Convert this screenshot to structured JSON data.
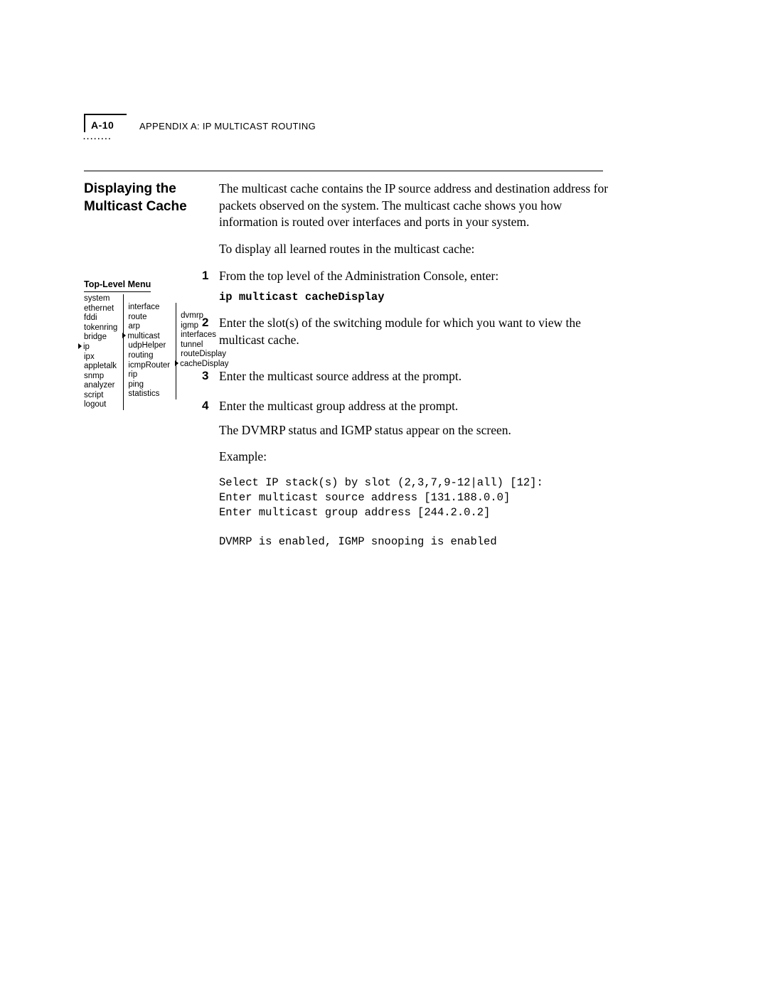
{
  "header": {
    "page_number": "A-10",
    "appendix_prefix": "A",
    "appendix_label": "PPENDIX",
    "appendix_letter": " A: IP M",
    "appendix_word2": "ULTICAST",
    "appendix_word3": " R",
    "appendix_word4": "OUTING"
  },
  "section": {
    "title": "Displaying the Multicast Cache"
  },
  "body": {
    "intro": "The multicast cache contains the IP source address and destination address for packets observed on the system. The multicast cache shows you how information is routed over interfaces and ports in your system.",
    "intro2": "To display all learned routes in the multicast cache:",
    "step1": "From the top level of the Administration Console, enter:",
    "cmd": "ip multicast cacheDisplay",
    "step2": "Enter the slot(s) of the switching module for which you want to view the multicast cache.",
    "step3": "Enter the multicast source address at the prompt.",
    "step4": "Enter the multicast group address at the prompt.",
    "status": "The DVMRP status and IGMP status appear on the screen.",
    "example_label": "Example:",
    "example_block": "Select IP stack(s) by slot (2,3,7,9-12|all) [12]:\nEnter multicast source address [131.188.0.0]\nEnter multicast group address [244.2.0.2]\n\nDVMRP is enabled, IGMP snooping is enabled"
  },
  "menu": {
    "title": "Top-Level Menu",
    "col1": [
      "system",
      "ethernet",
      "fddi",
      "tokenring",
      "bridge",
      "ip",
      "ipx",
      "appletalk",
      "snmp",
      "analyzer",
      "script",
      "logout"
    ],
    "col1_marker_index": 5,
    "col2": [
      "interface",
      "route",
      "arp",
      "multicast",
      "udpHelper",
      "routing",
      "icmpRouter",
      "rip",
      "ping",
      "statistics"
    ],
    "col2_marker_index": 3,
    "col3": [
      "dvmrp",
      "igmp",
      "interfaces",
      "tunnel",
      "routeDisplay",
      "cacheDisplay"
    ],
    "col3_marker_index": 5
  }
}
